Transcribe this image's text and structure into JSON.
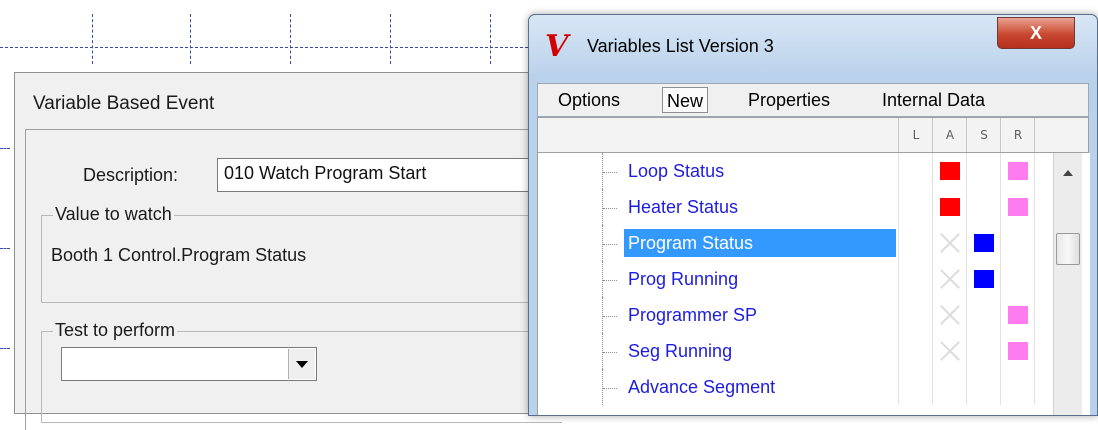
{
  "vbe": {
    "title": "Variable Based Event",
    "description_label": "Description:",
    "description_value": "010 Watch Program Start",
    "value_group_label": "Value to watch",
    "value_to_watch": "Booth 1 Control.Program Status",
    "test_group_label": "Test to perform",
    "test_value": ""
  },
  "vl": {
    "logo": "V",
    "title": "Variables List Version 3",
    "close_label": "X",
    "menu": [
      "Options",
      "New",
      "Properties",
      "Internal Data"
    ],
    "columns": [
      "L",
      "A",
      "S",
      "R"
    ],
    "rows": [
      {
        "label": "Loop Status",
        "a": "red",
        "s": "",
        "r": "pink"
      },
      {
        "label": "Heater Status",
        "a": "red",
        "s": "",
        "r": "pink"
      },
      {
        "label": "Program Status",
        "a": "x",
        "s": "blue",
        "r": "",
        "selected": true
      },
      {
        "label": "Prog Running",
        "a": "x",
        "s": "blue",
        "r": ""
      },
      {
        "label": "Programmer SP",
        "a": "x",
        "s": "",
        "r": "pink"
      },
      {
        "label": "Seg Running",
        "a": "x",
        "s": "",
        "r": "pink"
      },
      {
        "label": "Advance Segment",
        "a": "",
        "s": "",
        "r": ""
      }
    ],
    "colors": {
      "red": "#ff0000",
      "blue": "#0000ff",
      "pink": "#ff7cf0",
      "selection": "#3399ff"
    }
  }
}
